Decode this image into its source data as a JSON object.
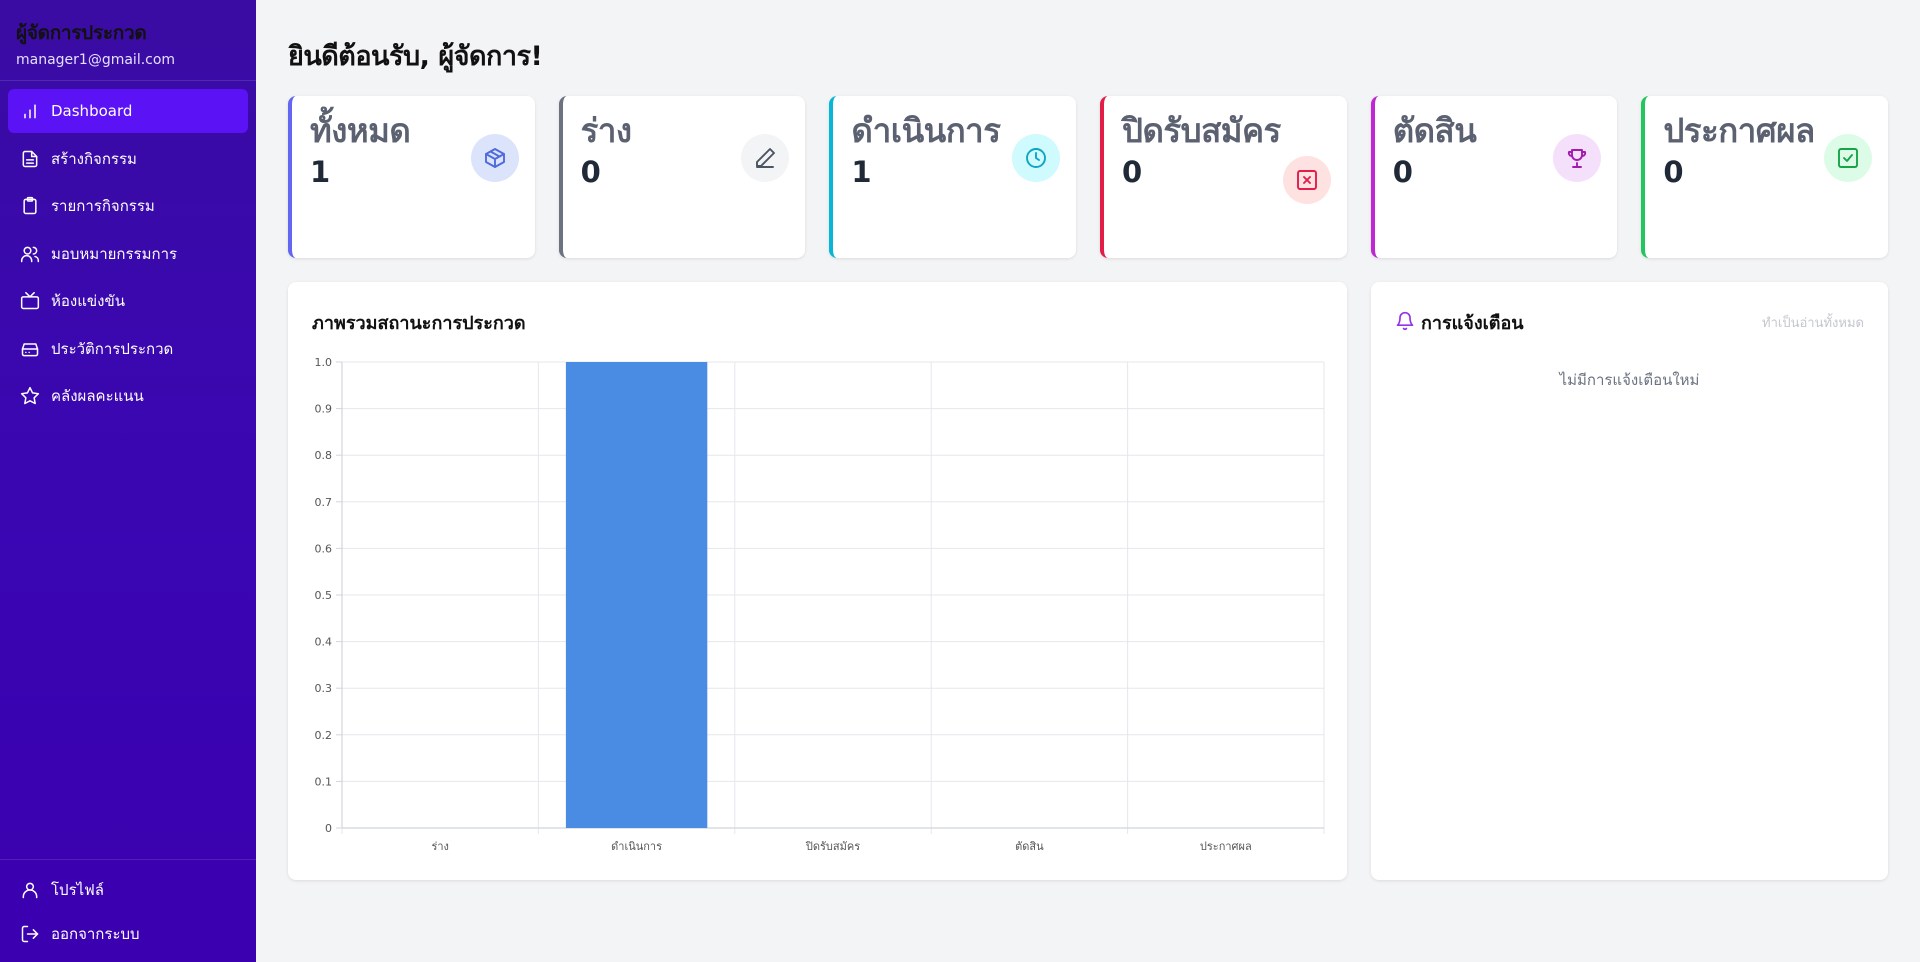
{
  "sidebar": {
    "role": "ผู้จัดการประกวด",
    "email": "manager1@gmail.com",
    "items": [
      {
        "label": "Dashboard",
        "icon": "bar-chart-icon",
        "active": true
      },
      {
        "label": "สร้างกิจกรรม",
        "icon": "document-icon"
      },
      {
        "label": "รายการกิจกรรม",
        "icon": "clipboard-icon"
      },
      {
        "label": "มอบหมายกรรมการ",
        "icon": "users-icon"
      },
      {
        "label": "ห้องแข่งขัน",
        "icon": "tv-icon"
      },
      {
        "label": "ประวัติการประกวด",
        "icon": "archive-icon"
      },
      {
        "label": "คลังผลคะแนน",
        "icon": "star-icon"
      }
    ],
    "bottom": [
      {
        "label": "โปรไฟล์",
        "icon": "user-icon"
      },
      {
        "label": "ออกจากระบบ",
        "icon": "logout-icon"
      }
    ]
  },
  "main": {
    "welcome": "ยินดีต้อนรับ, ผู้จัดการ!",
    "cards": [
      {
        "label": "ทั้งหมด",
        "value": "1",
        "color": "#6366f1",
        "icon_bg": "#dbe4fb",
        "icon_color": "#4f6bdc",
        "icon": "box-icon"
      },
      {
        "label": "ร่าง",
        "value": "0",
        "color": "#6b7280",
        "icon_bg": "#f3f4f6",
        "icon_color": "#4b5563",
        "icon": "pencil-icon"
      },
      {
        "label": "ดำเนินการ",
        "value": "1",
        "color": "#06b6d4",
        "icon_bg": "#cffafe",
        "icon_color": "#0ea5c4",
        "icon": "clock-icon"
      },
      {
        "label": "ปิดรับสมัคร",
        "value": "0",
        "color": "#e11d48",
        "icon_bg": "#fee2e2",
        "icon_color": "#e11d48",
        "icon": "x-square-icon"
      },
      {
        "label": "ตัดสิน",
        "value": "0",
        "color": "#c026d3",
        "icon_bg": "#f5e0fb",
        "icon_color": "#a21caf",
        "icon": "trophy-icon"
      },
      {
        "label": "ประกาศผล",
        "value": "0",
        "color": "#22c55e",
        "icon_bg": "#dcfce7",
        "icon_color": "#16a34a",
        "icon": "check-square-icon"
      }
    ]
  },
  "chart_panel": {
    "title": "ภาพรวมสถานะการประกวด"
  },
  "chart_data": {
    "type": "bar",
    "categories": [
      "ร่าง",
      "ดำเนินการ",
      "ปิดรับสมัคร",
      "ตัดสิน",
      "ประกาศผล"
    ],
    "values": [
      0,
      1,
      0,
      0,
      0
    ],
    "ylim": [
      0,
      1
    ],
    "yticks": [
      "0",
      "0.1",
      "0.2",
      "0.3",
      "0.4",
      "0.5",
      "0.6",
      "0.7",
      "0.8",
      "0.9",
      "1.0"
    ],
    "bar_color": "#4a8be4",
    "grid": true,
    "title": "",
    "xlabel": "",
    "ylabel": ""
  },
  "notifications": {
    "title": "การแจ้งเตือน",
    "mark_all": "ทำเป็นอ่านทั้งหมด",
    "empty": "ไม่มีการแจ้งเตือนใหม่"
  }
}
